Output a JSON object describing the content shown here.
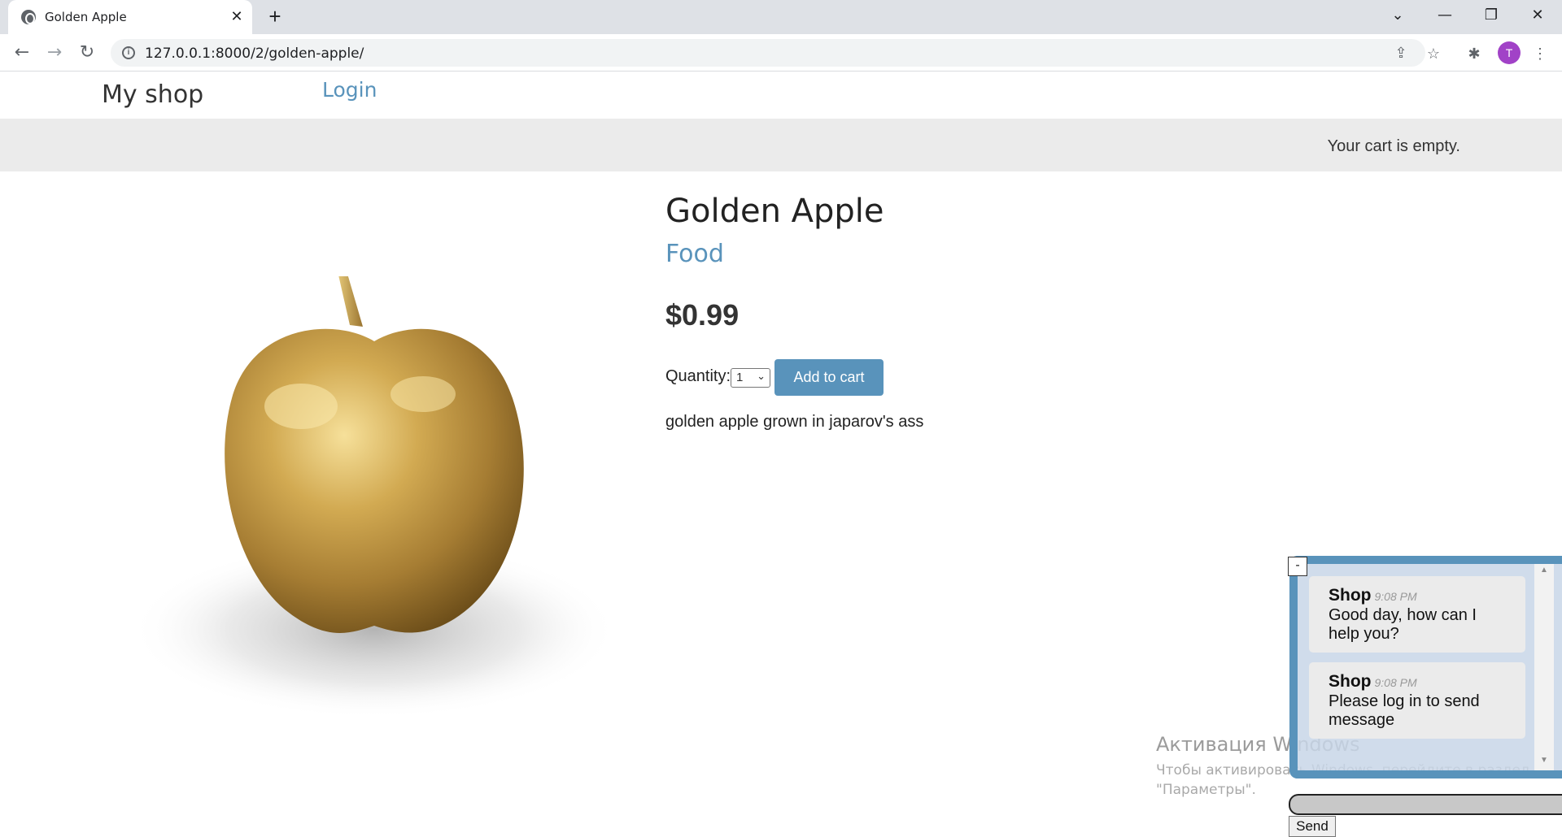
{
  "browser": {
    "tab_title": "Golden Apple",
    "tab_close": "✕",
    "new_tab": "+",
    "url": "127.0.0.1:8000/2/golden-apple/",
    "avatar_initial": "T",
    "icons": [
      "globe-icon",
      "back-icon",
      "forward-icon",
      "reload-icon",
      "info-icon",
      "share-icon",
      "star-icon",
      "extensions-icon",
      "menu-icon"
    ]
  },
  "header": {
    "logo": "My shop",
    "login": "Login"
  },
  "cart": {
    "status": "Your cart is empty."
  },
  "product": {
    "title": "Golden Apple",
    "category": "Food",
    "price": "$0.99",
    "quantity_label": "Quantity:",
    "quantity_value": "1",
    "add_to_cart": "Add to cart",
    "description": "golden apple grown in japarov's ass",
    "image_colors": {
      "gold_light": "#f3d98a",
      "gold_mid": "#c9a04a",
      "gold_dark": "#7a5a1e"
    }
  },
  "watermark": {
    "title": "Активация Windows",
    "subtitle": "Чтобы активировать Windows, перейдите в раздел \"Параметры\"."
  },
  "chat": {
    "minimize": "-",
    "messages": [
      {
        "author": "Shop",
        "time": "9:08 PM",
        "text": "Good day, how can I help you?"
      },
      {
        "author": "Shop",
        "time": "9:08 PM",
        "text": "Please log in to send message"
      }
    ],
    "send": "Send"
  },
  "colors": {
    "accent": "#5993bb",
    "cart_bar": "#ebebeb",
    "chrome": "#dee1e6"
  }
}
